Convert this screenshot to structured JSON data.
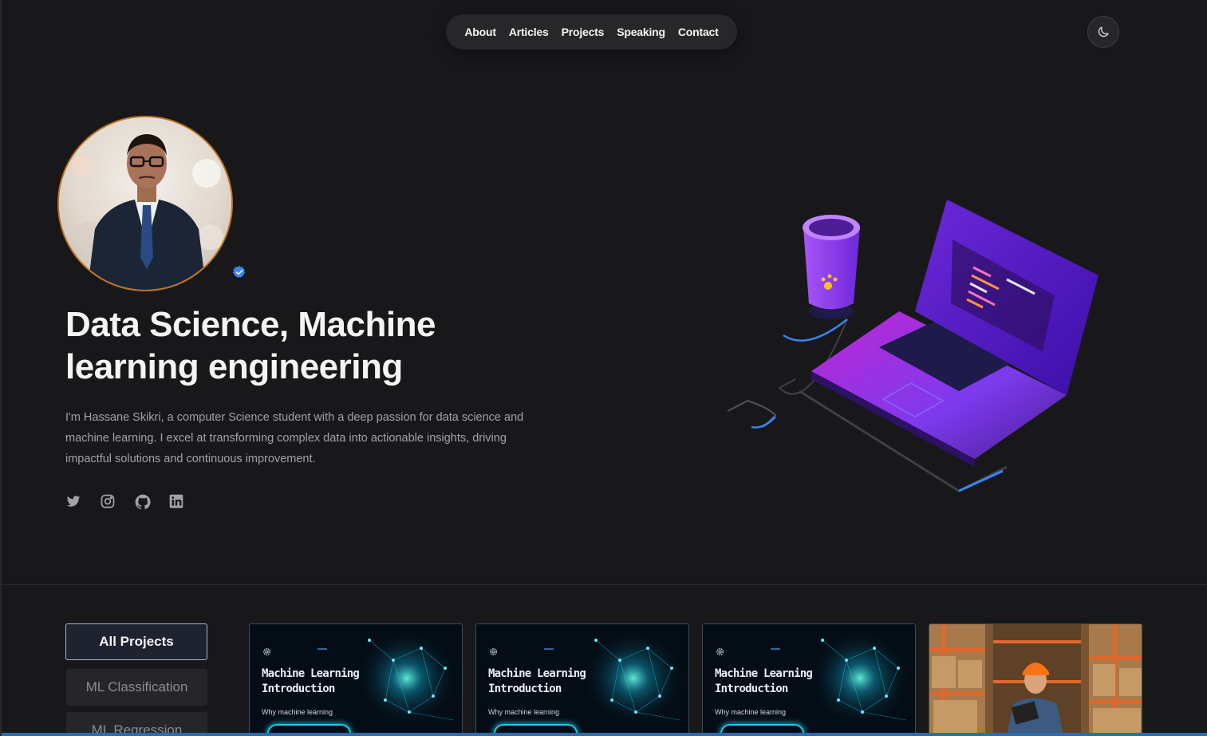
{
  "nav": {
    "items": [
      "About",
      "Articles",
      "Projects",
      "Speaking",
      "Contact"
    ],
    "theme_toggle_icon": "moon-icon"
  },
  "hero": {
    "title": "Data Science, Machine learning engineering",
    "description": "I'm Hassane Skikri, a computer Science student with a deep passion for data science and machine learning. I excel at transforming complex data into actionable insights, driving impactful solutions and continuous improvement.",
    "socials": [
      "twitter-icon",
      "instagram-icon",
      "github-icon",
      "linkedin-icon"
    ]
  },
  "projects": {
    "filters": [
      {
        "label": "All Projects",
        "active": true
      },
      {
        "label": "ML Classification",
        "active": false
      },
      {
        "label": "ML Regression",
        "active": false
      }
    ],
    "cards": [
      {
        "title_line1": "Machine Learning",
        "title_line2": "Introduction",
        "subtitle": "Why machine learning"
      },
      {
        "title_line1": "Machine Learning",
        "title_line2": "Introduction",
        "subtitle": "Why machine learning"
      },
      {
        "title_line1": "Machine Learning",
        "title_line2": "Introduction",
        "subtitle": "Why machine learning"
      }
    ]
  },
  "colors": {
    "background": "#18181b",
    "nav_background": "#27272a",
    "avatar_ring": "#c2721d",
    "verified_badge": "#3b82f6",
    "accent_cyan": "#14d0e6",
    "accent_purple": "#7c3aed"
  }
}
